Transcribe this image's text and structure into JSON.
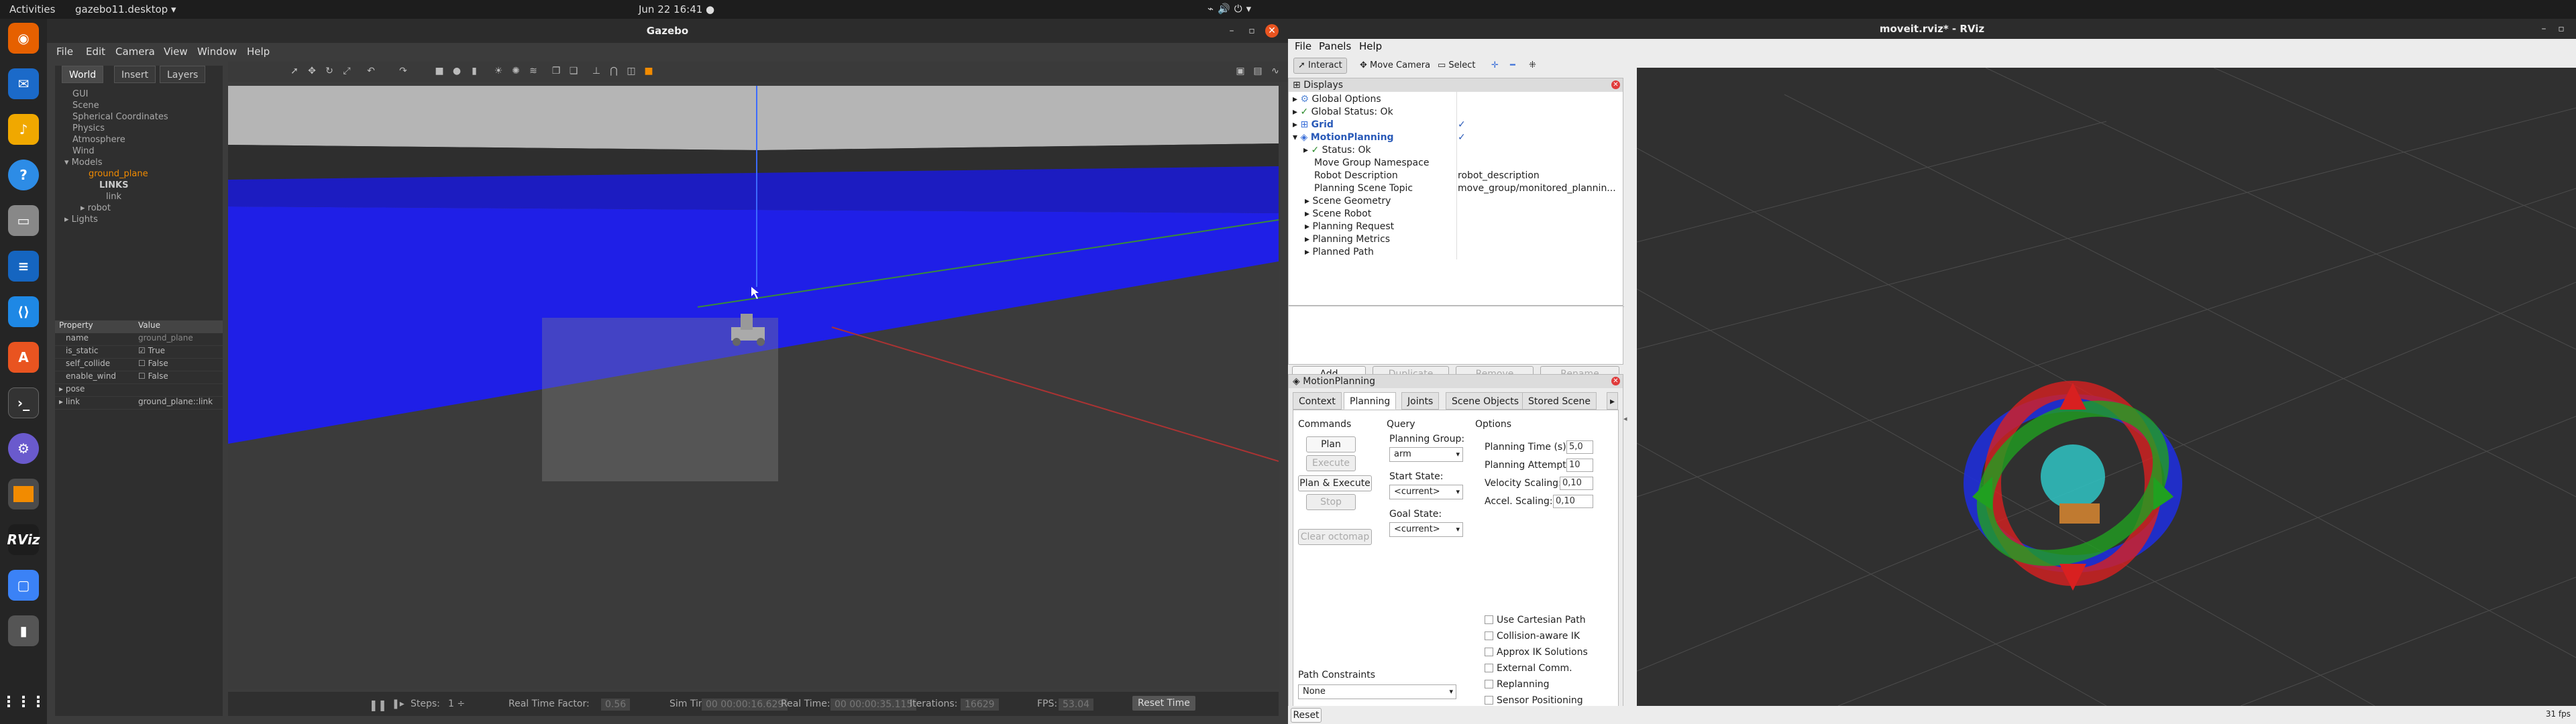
{
  "topbar": {
    "activities": "Activities",
    "app": "gazebo11.desktop ▾",
    "clock": "Jun 22  16:41  ●"
  },
  "dock": {
    "items": [
      "firefox-icon",
      "thunderbird-icon",
      "rhythmbox-icon",
      "help-icon",
      "files-icon",
      "writer-icon",
      "vscode-icon",
      "software-icon",
      "terminal-icon",
      "settings-icon",
      "gazebo-icon",
      "rviz-icon",
      "screenshot-icon",
      "usb-icon",
      "apps-grid-icon"
    ],
    "rviz_label": "RViz"
  },
  "gazebo": {
    "title": "Gazebo",
    "menu": [
      "File",
      "Edit",
      "Camera",
      "View",
      "Window",
      "Help"
    ],
    "tabs": [
      "World",
      "Insert",
      "Layers"
    ],
    "tree": [
      "GUI",
      "Scene",
      "Spherical Coordinates",
      "Physics",
      "Atmosphere",
      "Wind",
      "Models",
      "ground_plane",
      "LINKS",
      "link",
      "robot",
      "Lights"
    ],
    "props": {
      "header": [
        "Property",
        "Value"
      ],
      "rows": [
        [
          "name",
          "ground_plane"
        ],
        [
          "is_static",
          "True"
        ],
        [
          "self_collide",
          "False"
        ],
        [
          "enable_wind",
          "False"
        ],
        [
          "pose",
          ""
        ],
        [
          "link",
          "ground_plane::link"
        ]
      ]
    },
    "bottom": {
      "steps": "Steps:",
      "steps_val": "1 ÷",
      "rtf": "Real Time Factor:",
      "rtf_val": "0.56",
      "sim": "Sim Time:",
      "sim_val": "00 00:00:16.629",
      "real": "Real Time:",
      "real_val": "00 00:00:35.115",
      "iter": "Iterations:",
      "iter_val": "16629",
      "fps": "FPS:",
      "fps_val": "53.04",
      "reset": "Reset Time"
    }
  },
  "rviz": {
    "title": "moveit.rviz* - RViz",
    "menu": [
      "File",
      "Panels",
      "Help"
    ],
    "tools": [
      "Interact",
      "Move Camera",
      "Select"
    ],
    "displays_title": "Displays",
    "displays": [
      {
        "label": "Global Options"
      },
      {
        "label": "Global Status: Ok"
      },
      {
        "label": "Grid",
        "value": "✓"
      },
      {
        "label": "MotionPlanning",
        "value": "✓"
      },
      {
        "label": "Status: Ok"
      },
      {
        "label": "Move Group Namespace"
      },
      {
        "label": "Robot Description",
        "value": "robot_description"
      },
      {
        "label": "Planning Scene Topic",
        "value": "move_group/monitored_plannin..."
      },
      {
        "label": "Scene Geometry"
      },
      {
        "label": "Scene Robot"
      },
      {
        "label": "Planning Request"
      },
      {
        "label": "Planning Metrics"
      },
      {
        "label": "Planned Path"
      }
    ],
    "disp_buttons": [
      "Add",
      "Duplicate",
      "Remove",
      "Rename"
    ],
    "mp_title": "MotionPlanning",
    "mp_tabs": [
      "Context",
      "Planning",
      "Joints",
      "Scene Objects",
      "Stored Scene"
    ],
    "commands_label": "Commands",
    "query_label": "Query",
    "options_label": "Options",
    "commands": [
      "Plan",
      "Execute",
      "Plan & Execute",
      "Stop",
      "Clear octomap"
    ],
    "planning_group_label": "Planning Group:",
    "planning_group": "arm",
    "start_state_label": "Start State:",
    "start_state": "<current>",
    "goal_state_label": "Goal State:",
    "goal_state": "<current>",
    "opts": [
      [
        "Planning Time (s):",
        "5,0"
      ],
      [
        "Planning Attempts:",
        "10"
      ],
      [
        "Velocity Scaling:",
        "0,10"
      ],
      [
        "Accel. Scaling:",
        "0,10"
      ]
    ],
    "checks": [
      "Use Cartesian Path",
      "Collision-aware IK",
      "Approx IK Solutions",
      "External Comm.",
      "Replanning",
      "Sensor Positioning"
    ],
    "path_constraints_label": "Path Constraints",
    "path_constraints": "None",
    "reset": "Reset",
    "fps": "31 fps"
  }
}
